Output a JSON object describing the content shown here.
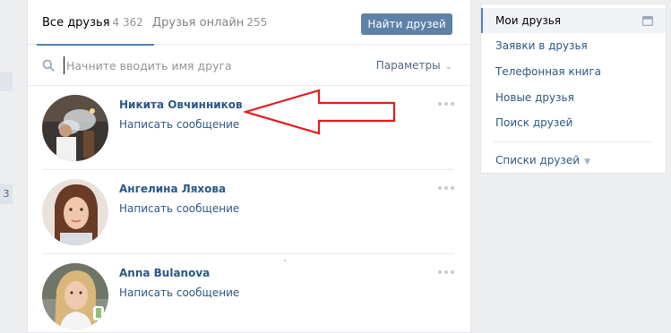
{
  "tabs": {
    "all_label": "Все друзья",
    "all_count": "4 362",
    "online_label": "Друзья онлайн",
    "online_count": "255"
  },
  "find_button": "Найти друзей",
  "search": {
    "placeholder": "Начните вводить имя друга",
    "params_label": "Параметры"
  },
  "friends": [
    {
      "name": "Никита Овчинников",
      "action": "Написать сообщение"
    },
    {
      "name": "Ангелина Ляхова",
      "action": "Написать сообщение"
    },
    {
      "name": "Anna Bulanova",
      "action": "Написать сообщение"
    }
  ],
  "left_badge": "3",
  "sidebar": {
    "items": [
      {
        "label": "Мои друзья"
      },
      {
        "label": "Заявки в друзья"
      },
      {
        "label": "Телефонная книга"
      },
      {
        "label": "Новые друзья"
      },
      {
        "label": "Поиск друзей"
      }
    ],
    "lists_label": "Списки друзей"
  },
  "colors": {
    "accent": "#5181b8",
    "link": "#2a5885",
    "button": "#5e81a8",
    "arrow": "#e21b1b",
    "background": "#edeef0"
  },
  "icons": [
    "search-icon",
    "chevron-down-icon",
    "more-icon",
    "mobile-icon",
    "calendar-icon",
    "triangle-down-icon"
  ]
}
